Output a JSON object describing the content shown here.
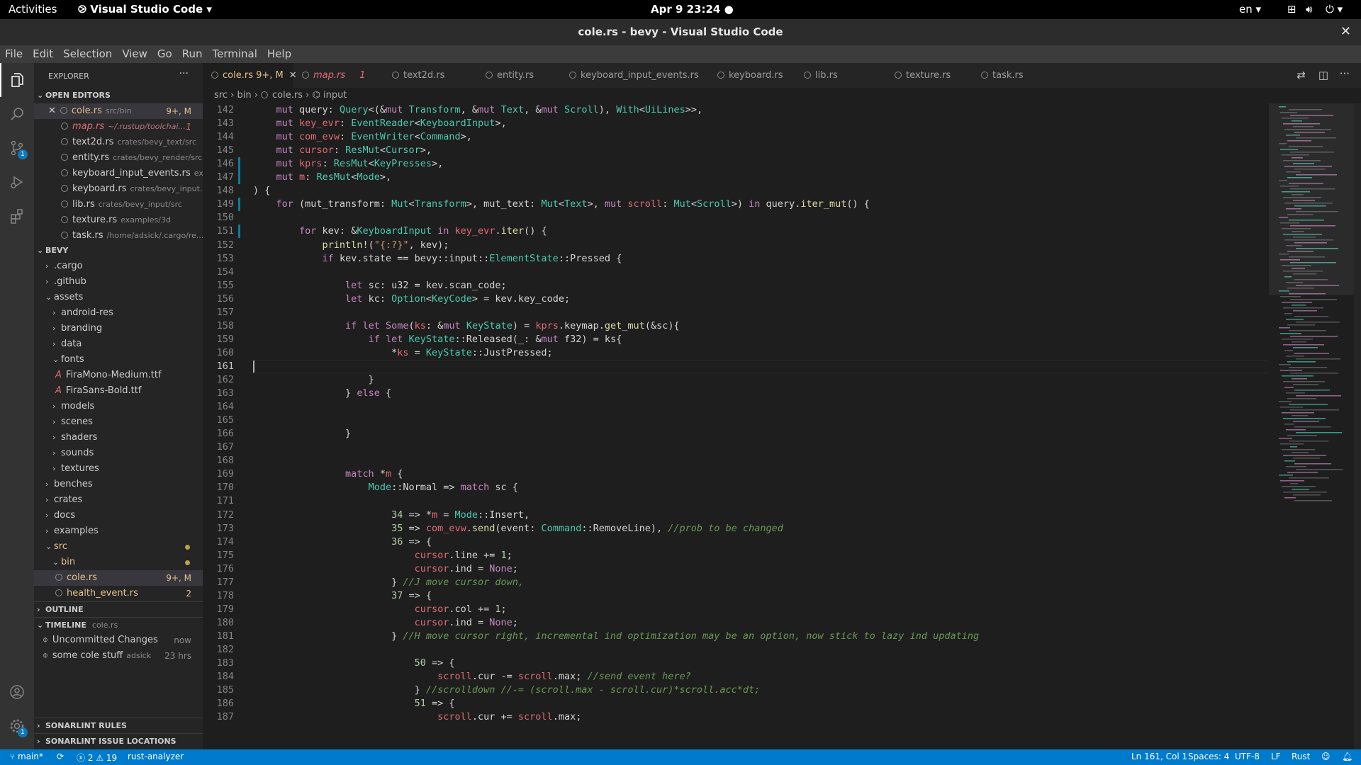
{
  "gnome": {
    "activities": "Activities",
    "app_name": "Visual Studio Code",
    "clock": "Apr 9  23:24",
    "lang": "en"
  },
  "window": {
    "title": "cole.rs - bevy - Visual Studio Code"
  },
  "menu": [
    "File",
    "Edit",
    "Selection",
    "View",
    "Go",
    "Run",
    "Terminal",
    "Help"
  ],
  "activity_bar": {
    "icons": [
      "files-icon",
      "search-icon",
      "source-control-icon",
      "run-debug-icon",
      "extensions-icon",
      "account-icon",
      "settings-gear-icon"
    ],
    "source_control_badge": "1",
    "settings_badge": "1"
  },
  "explorer": {
    "title": "EXPLORER",
    "open_editors_header": "OPEN EDITORS",
    "open_editors": [
      {
        "name": "cole.rs",
        "path": "src/bin",
        "badge": "9+, M"
      },
      {
        "name": "map.rs",
        "path": "~/.rustup/toolchai...",
        "badge": "1"
      },
      {
        "name": "text2d.rs",
        "path": "crates/bevy_text/src",
        "badge": ""
      },
      {
        "name": "entity.rs",
        "path": "crates/bevy_render/src",
        "badge": ""
      },
      {
        "name": "keyboard_input_events.rs",
        "path": "ex...",
        "badge": ""
      },
      {
        "name": "keyboard.rs",
        "path": "crates/bevy_input...",
        "badge": ""
      },
      {
        "name": "lib.rs",
        "path": "crates/bevy_input/src",
        "badge": ""
      },
      {
        "name": "texture.rs",
        "path": "examples/3d",
        "badge": ""
      },
      {
        "name": "task.rs",
        "path": "/home/adsick/.cargo/re...",
        "badge": ""
      }
    ],
    "project_header": "BEVY",
    "tree": [
      ".cargo",
      ".github",
      "assets",
      "android-res",
      "branding",
      "data",
      "fonts",
      "FiraMono-Medium.ttf",
      "FiraSans-Bold.ttf",
      "models",
      "scenes",
      "shaders",
      "sounds",
      "textures",
      "benches",
      "crates",
      "docs",
      "examples",
      "src",
      "bin",
      "cole.rs",
      "health_event.rs"
    ],
    "cole_badge": "9+, M",
    "health_badge": "2",
    "outline_header": "OUTLINE",
    "timeline_header": "TIMELINE",
    "timeline_file": "cole.rs",
    "timeline": [
      {
        "label": "Uncommitted Changes",
        "when": "now",
        "author": ""
      },
      {
        "label": "some cole stuff",
        "when": "23 hrs",
        "author": "adsick"
      }
    ],
    "sonar_rules": "SONARLINT RULES",
    "sonar_issues": "SONARLINT ISSUE LOCATIONS"
  },
  "tabs": [
    {
      "name": "cole.rs",
      "badge": "9+, M"
    },
    {
      "name": "map.rs",
      "badge": "1"
    },
    {
      "name": "text2d.rs",
      "badge": ""
    },
    {
      "name": "entity.rs",
      "badge": ""
    },
    {
      "name": "keyboard_input_events.rs",
      "badge": ""
    },
    {
      "name": "keyboard.rs",
      "badge": ""
    },
    {
      "name": "lib.rs",
      "badge": ""
    },
    {
      "name": "texture.rs",
      "badge": ""
    },
    {
      "name": "task.rs",
      "badge": ""
    }
  ],
  "breadcrumb": [
    "src",
    "bin",
    "cole.rs",
    "input"
  ],
  "editor": {
    "first_line": 142,
    "current_line": 161,
    "lines": [
      "    mut query: Query<(&mut Transform, &mut Text, &mut Scroll), With<UiLines>>,",
      "    mut key_evr: EventReader<KeyboardInput>,",
      "    mut com_evw: EventWriter<Command>,",
      "    mut cursor: ResMut<Cursor>,",
      "    mut kprs: ResMut<KeyPresses>,",
      "    mut m: ResMut<Mode>,",
      ") {",
      "    for (mut_transform: Mut<Transform>, mut_text: Mut<Text>, mut scroll: Mut<Scroll>) in query.iter_mut() {",
      "",
      "        for kev: &KeyboardInput in key_evr.iter() {",
      "            println!(\"{:?}\", kev);",
      "            if kev.state == bevy::input::ElementState::Pressed {",
      "",
      "                let sc: u32 = kev.scan_code;",
      "                let kc: Option<KeyCode> = kev.key_code;",
      "",
      "                if let Some(ks: &mut KeyState) = kprs.keymap.get_mut(&sc){",
      "                    if let KeyState::Released(_: &mut f32) = ks{",
      "                        *ks = KeyState::JustPressed;",
      "",
      "                    }",
      "                } else {",
      "",
      "",
      "                }",
      "",
      "",
      "                match *m {",
      "                    Mode::Normal => match sc {",
      "",
      "                        34 => *m = Mode::Insert,",
      "                        35 => com_evw.send(event: Command::RemoveLine), //prob to be changed",
      "                        36 => {",
      "                            cursor.line += 1;",
      "                            cursor.ind = None;",
      "                        } //J move cursor down,",
      "                        37 => {",
      "                            cursor.col += 1;",
      "                            cursor.ind = None;",
      "                        } //H move cursor right, incremental ind optimization may be an option, now stick to lazy ind updating",
      "",
      "                            50 => {",
      "                                scroll.cur -= scroll.max; //send event here?",
      "                            } //scrolldown //-= (scroll.max - scroll.cur)*scroll.acc*dt;",
      "                            51 => {",
      "                                scroll.cur += scroll.max;"
    ]
  },
  "status": {
    "branch": "main*",
    "errors": "2",
    "warnings": "19",
    "analyzer": "rust-analyzer",
    "position": "Ln 161, Col 1",
    "spaces": "Spaces: 4",
    "encoding": "UTF-8",
    "eol": "LF",
    "language": "Rust"
  },
  "colors": {
    "status_bar": "#007acc",
    "modified_file": "#e2c08d",
    "error_file": "#e06c75",
    "badge": "#1177bb"
  }
}
